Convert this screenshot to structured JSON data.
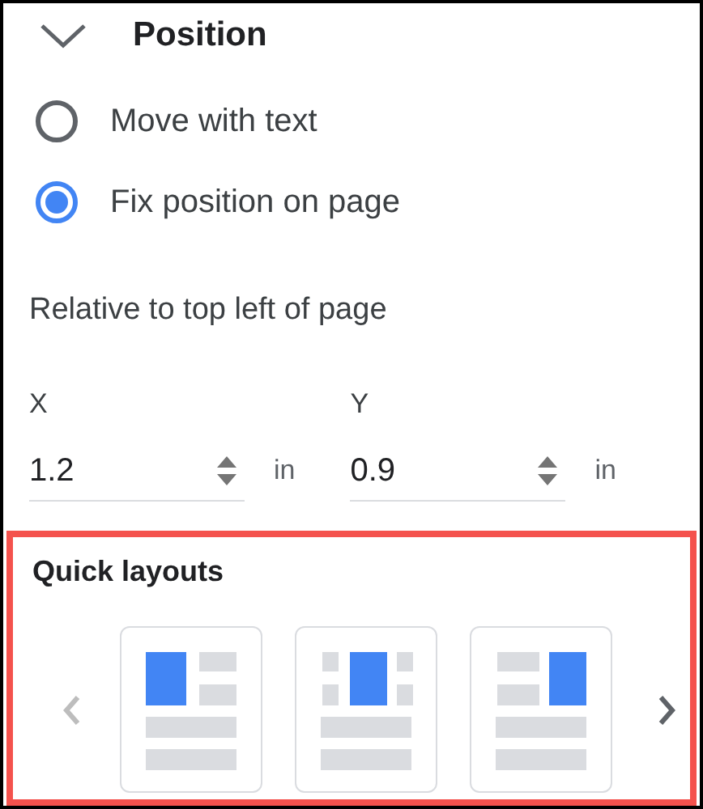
{
  "section": {
    "title": "Position",
    "expanded": true
  },
  "options": [
    {
      "label": "Move with text",
      "selected": false
    },
    {
      "label": "Fix position on page",
      "selected": true
    }
  ],
  "relative_label": "Relative to top left of page",
  "fields": [
    {
      "label": "X",
      "value": "1.2",
      "unit": "in"
    },
    {
      "label": "Y",
      "value": "0.9",
      "unit": "in"
    }
  ],
  "quick_layouts": {
    "title": "Quick layouts",
    "highlighted": true,
    "prev_disabled": true,
    "next_disabled": false,
    "layouts": [
      {
        "kind": "left"
      },
      {
        "kind": "center"
      },
      {
        "kind": "right"
      }
    ]
  }
}
